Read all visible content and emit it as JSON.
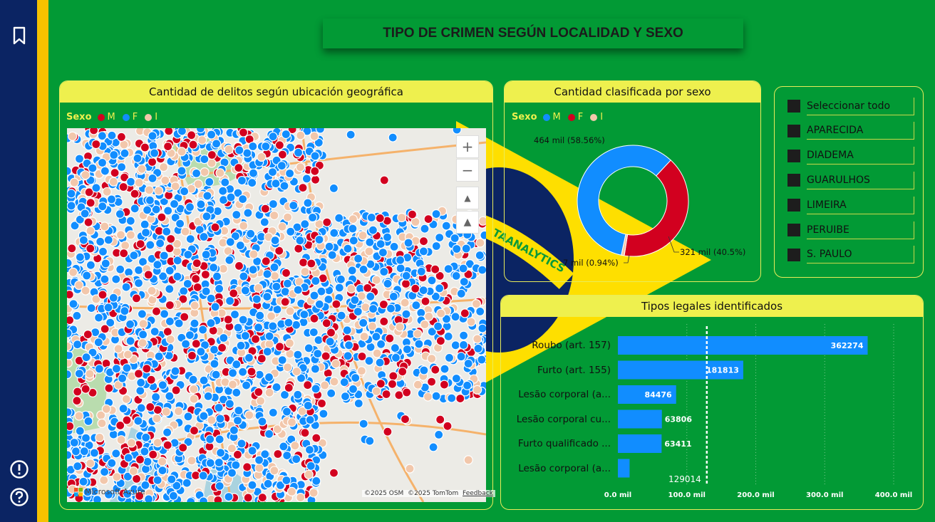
{
  "page_title": "TIPO DE CRIMEN SEGÚN LOCALIDAD Y SEXO",
  "sidebar": {
    "bookmark_icon": "bookmark-icon",
    "info_icon": "info-icon",
    "help_icon": "help-icon"
  },
  "watermark": "TAANALYTICS",
  "colors": {
    "M": "#d2001f",
    "F": "#118dff",
    "I": "#f2c7ab",
    "accent": "#eef04e",
    "background": "#029a35"
  },
  "map_panel": {
    "title": "Cantidad de delitos según ubicación geográfica",
    "legend_label": "Sexo",
    "legend": [
      "M",
      "F",
      "I"
    ],
    "attribution_osm": "©2025 OSM",
    "attribution_tomtom": "©2025 TomTom",
    "feedback": "Feedback",
    "provider": "Microsoft Azure"
  },
  "sex_panel": {
    "title": "Cantidad clasificada por sexo",
    "legend_label": "Sexo",
    "legend": [
      "M",
      "F",
      "I"
    ]
  },
  "slicer": {
    "items": [
      "Seleccionar todo",
      "APARECIDA",
      "DIADEMA",
      "GUARULHOS",
      "LIMEIRA",
      "PERUIBE",
      "S. PAULO"
    ]
  },
  "bars_panel": {
    "title": "Tipos legales identificados"
  },
  "chart_data": [
    {
      "type": "pie",
      "title": "Cantidad clasificada por sexo",
      "legend_title": "Sexo",
      "slices": [
        {
          "name": "M",
          "value": 321,
          "label": "321 mil (40.5%)"
        },
        {
          "name": "I",
          "value": 7,
          "label": "7 mil (0.94%)"
        },
        {
          "name": "F",
          "value": 464,
          "label": "464 mil (58.56%)"
        }
      ]
    },
    {
      "type": "bar",
      "orientation": "horizontal",
      "title": "Tipos legales identificados",
      "categories": [
        "Roubo (art. 157)",
        "Furto (art. 155)",
        "Lesão corporal (a...",
        "Lesão corporal cu...",
        "Furto qualificado ...",
        "Lesão corporal (a..."
      ],
      "values": [
        362274,
        181813,
        84476,
        63806,
        63411,
        17000
      ],
      "data_labels": [
        "362274",
        "181813",
        "84476",
        "63806",
        "63411",
        ""
      ],
      "xlim": [
        0,
        420000
      ],
      "x_ticks": [
        0,
        100000,
        200000,
        300000,
        400000
      ],
      "x_tick_labels": [
        "0.0 mil",
        "100.0 mil",
        "200.0 mil",
        "300.0 mil",
        "400.0 mil"
      ],
      "reference_line": {
        "value": 129014,
        "label": "129014"
      },
      "grid": true
    }
  ]
}
